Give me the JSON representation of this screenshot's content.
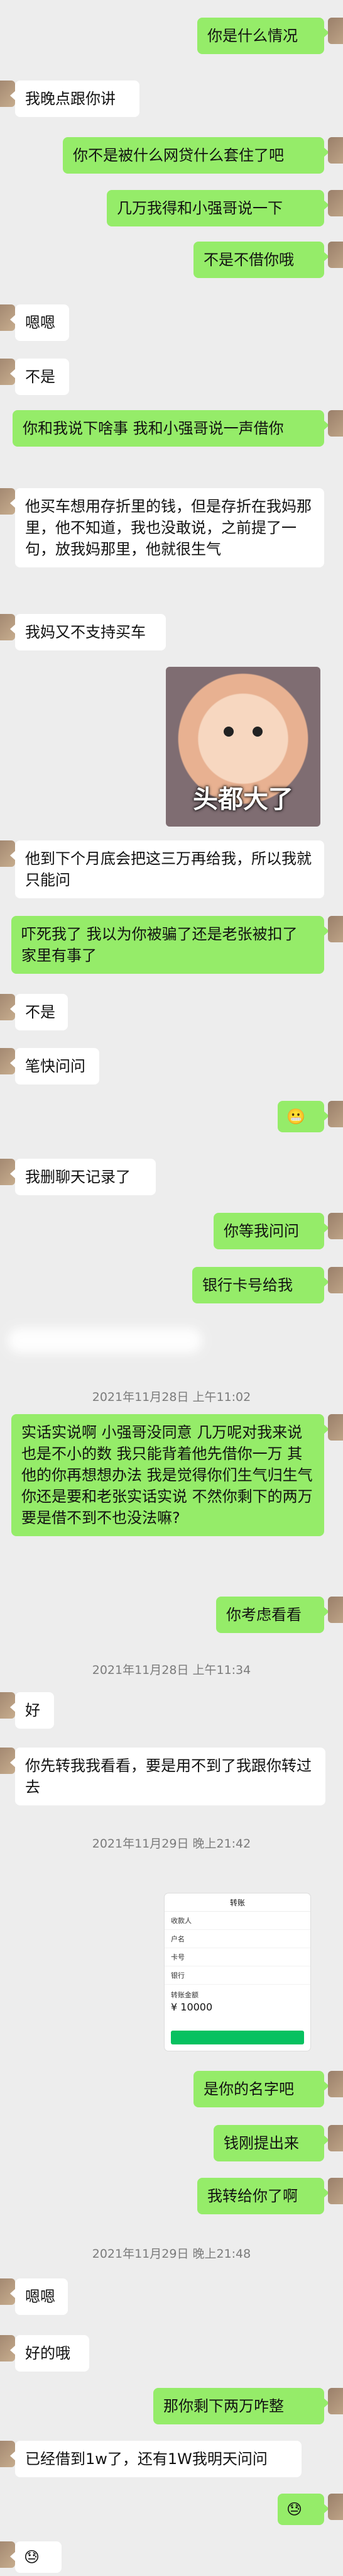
{
  "messages": [
    {
      "side": "right",
      "text": "你是什么情况"
    },
    {
      "side": "left",
      "text": "我晚点跟你讲"
    },
    {
      "side": "right",
      "text": "你不是被什么网贷什么套住了吧"
    },
    {
      "side": "right",
      "text": "几万我得和小强哥说一下"
    },
    {
      "side": "right",
      "text": "不是不借你哦"
    },
    {
      "side": "left",
      "text": "嗯嗯"
    },
    {
      "side": "left",
      "text": "不是"
    },
    {
      "side": "right",
      "text": "你和我说下啥事 我和小强哥说一声借你"
    },
    {
      "side": "left",
      "text": "他买车想用存折里的钱，但是存折在我妈那里，他不知道，我也没敢说，之前提了一句，放我妈那里，他就很生气"
    },
    {
      "side": "left",
      "text": "我妈又不支持买车"
    },
    {
      "side": "left",
      "text": "他到下个月底会把这三万再给我，所以我就只能问"
    },
    {
      "side": "right",
      "text": "吓死我了 我以为你被骗了还是老张被扣了 家里有事了"
    },
    {
      "side": "left",
      "text": "不是"
    },
    {
      "side": "left",
      "text": "笔快问问"
    },
    {
      "side": "right",
      "text": "😬"
    },
    {
      "side": "left",
      "text": "我删聊天记录了"
    },
    {
      "side": "right",
      "text": "你等我问问"
    },
    {
      "side": "right",
      "text": "银行卡号给我"
    },
    {
      "side": "right",
      "text": "实话实说啊 小强哥没同意 几万呢对我来说也是不小的数 我只能背着他先借你一万 其他的你再想想办法 我是觉得你们生气归生气 你还是要和老张实话实说 不然你剩下的两万要是借不到不也没法嘛?"
    },
    {
      "side": "right",
      "text": "你考虑看看"
    },
    {
      "side": "left",
      "text": "好"
    },
    {
      "side": "left",
      "text": "你先转我我看看，要是用不到了我跟你转过去"
    },
    {
      "side": "right",
      "text": "是你的名字吧"
    },
    {
      "side": "right",
      "text": "钱刚提出来"
    },
    {
      "side": "right",
      "text": "我转给你了啊"
    },
    {
      "side": "left",
      "text": "嗯嗯"
    },
    {
      "side": "left",
      "text": "好的哦"
    },
    {
      "side": "right",
      "text": "那你剩下两万咋整"
    },
    {
      "side": "left",
      "text": "已经借到1w了，还有1W我明天问问"
    },
    {
      "side": "right",
      "text": "😓"
    },
    {
      "side": "left",
      "text": "😓"
    }
  ],
  "timestamps": [
    "2021年11月28日 上午11:02",
    "2021年11月28日 上午11:34",
    "2021年11月29日 晚上21:42",
    "2021年11月29日 晚上21:48"
  ],
  "sticker_caption": "头都大了",
  "transfer": {
    "title": "转账",
    "payee": "收款人",
    "account_label": "户名",
    "card_label": "卡号",
    "bank_label": "银行",
    "amount_label": "转账金额",
    "amount": "¥ 10000"
  },
  "colors": {
    "background": "#ededed",
    "sent_bubble": "#95ec69",
    "received_bubble": "#ffffff"
  }
}
